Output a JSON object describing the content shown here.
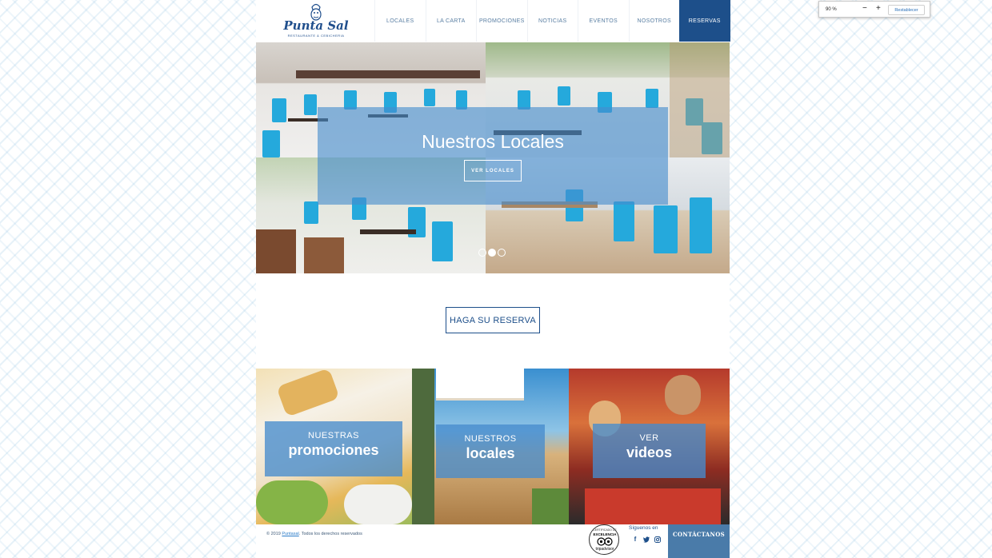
{
  "browser": {
    "zoom": {
      "value": "90 %",
      "minus_symbol": "−",
      "plus_symbol": "+",
      "reset_label": "Restablecer"
    }
  },
  "header": {
    "logo": {
      "text": "Punta Sal",
      "subtitle": "RESTAURANTE & CEBICHERIA"
    },
    "nav": [
      {
        "label": "LOCALES"
      },
      {
        "label": "LA CARTA"
      },
      {
        "label": "PROMOCIONES"
      },
      {
        "label": "NOTICIAS"
      },
      {
        "label": "EVENTOS"
      },
      {
        "label": "NOSOTROS"
      },
      {
        "label": "RESERVAS",
        "active": true
      }
    ]
  },
  "hero": {
    "title": "Nuestros Locales",
    "button_label": "VER LOCALES",
    "slides_count": 3,
    "active_slide": 2
  },
  "reserve": {
    "button_label": "HAGA SU RESERVA"
  },
  "cards": [
    {
      "small": "NUESTRAS",
      "big": "promociones"
    },
    {
      "small": "NUESTROS",
      "big": "locales"
    },
    {
      "small": "VER",
      "big": "videos"
    }
  ],
  "footer": {
    "copyright_prefix": "© 2019 ",
    "copyright_link": "Puntasal",
    "copyright_suffix": ". Todos los derechos reservados",
    "tripadvisor": {
      "top": "CERTIFICADO DE",
      "mid": "EXCELENCIA",
      "bottom": "tripadvisor"
    },
    "social_title": "Síguenos en",
    "social": [
      "facebook-icon",
      "twitter-icon",
      "instagram-icon"
    ],
    "contact_label": "CONTÁCTANOS"
  },
  "colors": {
    "brand_blue": "#1d4f8a",
    "overlay_blue": "#468ccd",
    "chair_blue": "#25a9dc"
  }
}
